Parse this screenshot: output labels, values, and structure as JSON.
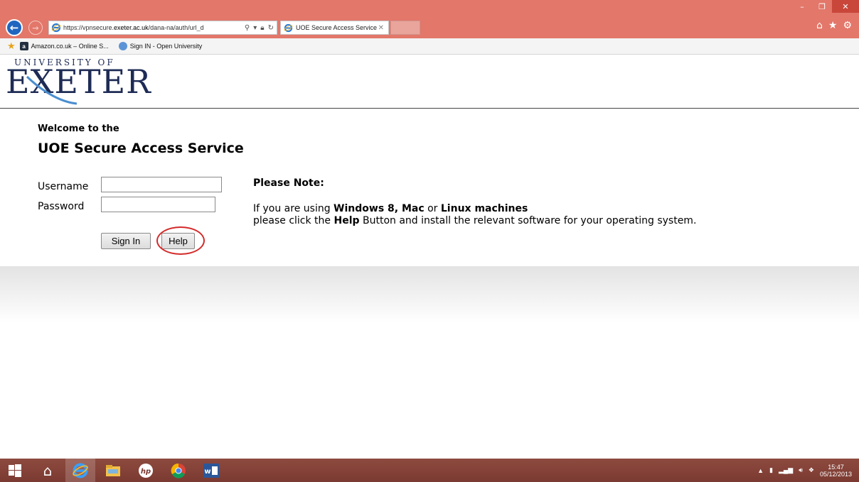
{
  "browser": {
    "url_prefix": "https://vpnsecure.",
    "url_domain": "exeter.ac.uk",
    "url_path": "/dana-na/auth/url_d",
    "tab_title": "UOE Secure Access Service",
    "window_controls": [
      "–",
      "❐",
      "✕"
    ]
  },
  "favorites": [
    {
      "label": "Amazon.co.uk – Online S...",
      "icon": "amazon-icon"
    },
    {
      "label": "Sign IN - Open University",
      "icon": "ou-icon"
    }
  ],
  "logo": {
    "small": "UNIVERSITY OF",
    "big": "EXETER"
  },
  "welcome": {
    "line1": "Welcome to the",
    "line2": "UOE Secure Access Service"
  },
  "form": {
    "username_label": "Username",
    "password_label": "Password",
    "username_value": "",
    "password_value": "",
    "signin_label": "Sign In",
    "help_label": "Help"
  },
  "note": {
    "title": "Please Note:",
    "line1_prefix": "If you are using ",
    "line1_bold1": "Windows 8, Mac",
    "line1_mid": " or ",
    "line1_bold2": "Linux machines",
    "line2_prefix": "please click the ",
    "line2_bold": "Help",
    "line2_suffix": " Button and install the relevant software for your operating system."
  },
  "taskbar": {
    "time": "15:47",
    "date": "05/12/2013"
  },
  "colors": {
    "chrome": "#e2776a",
    "highlight": "#d42a2a",
    "logo": "#1e2b55"
  }
}
